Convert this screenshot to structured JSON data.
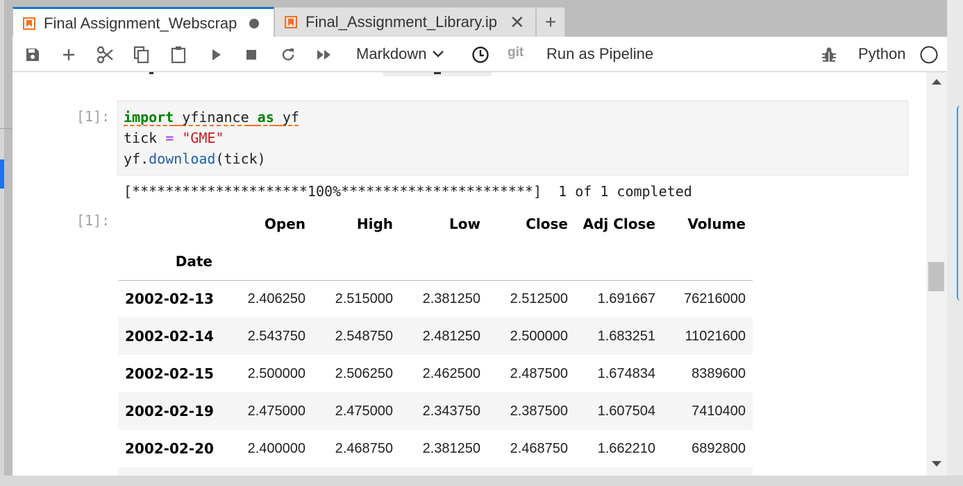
{
  "tabs": [
    {
      "title": "Final Assignment_Webscraping.ipynb",
      "display": "Final Assignment_Webscrap",
      "active": true,
      "dirty": true
    },
    {
      "title": "Final_Assignment_Library.ipynb",
      "display": "Final_Assignment_Library.ip",
      "active": false,
      "close_glyph": "✕"
    }
  ],
  "add_tab_glyph": "+",
  "toolbar": {
    "icons": [
      "save-icon",
      "add-cell-icon",
      "cut-icon",
      "copy-icon",
      "paste-icon",
      "run-icon",
      "stop-icon",
      "restart-icon",
      "fast-forward-icon"
    ],
    "cell_type": "Markdown",
    "git_label": "git",
    "run_pipeline": "Run as Pipeline",
    "kernel": "Python"
  },
  "cell": {
    "prompt": "[1]:",
    "code_line1_kw": "import",
    "code_line1_mod": "yfinance",
    "code_line1_as": "as",
    "code_line1_alias": "yf",
    "code_line2_var": "tick",
    "code_line2_op": "=",
    "code_line2_str": "\"GME\"",
    "code_line3_obj": "yf.",
    "code_line3_fn": "download",
    "code_line3_args": "(tick)",
    "stream": "[*********************100%***********************]  1 of 1 completed",
    "output_prompt": "[1]:"
  },
  "dataframe": {
    "columns": [
      "Open",
      "High",
      "Low",
      "Close",
      "Adj Close",
      "Volume"
    ],
    "index_name": "Date",
    "rows": [
      {
        "date": "2002-02-13",
        "values": [
          "2.406250",
          "2.515000",
          "2.381250",
          "2.512500",
          "1.691667",
          "76216000"
        ]
      },
      {
        "date": "2002-02-14",
        "values": [
          "2.543750",
          "2.548750",
          "2.481250",
          "2.500000",
          "1.683251",
          "11021600"
        ]
      },
      {
        "date": "2002-02-15",
        "values": [
          "2.500000",
          "2.506250",
          "2.462500",
          "2.487500",
          "1.674834",
          "8389600"
        ]
      },
      {
        "date": "2002-02-19",
        "values": [
          "2.475000",
          "2.475000",
          "2.343750",
          "2.387500",
          "1.607504",
          "7410400"
        ]
      },
      {
        "date": "2002-02-20",
        "values": [
          "2.400000",
          "2.468750",
          "2.381250",
          "2.468750",
          "1.662210",
          "6892800"
        ]
      }
    ]
  }
}
